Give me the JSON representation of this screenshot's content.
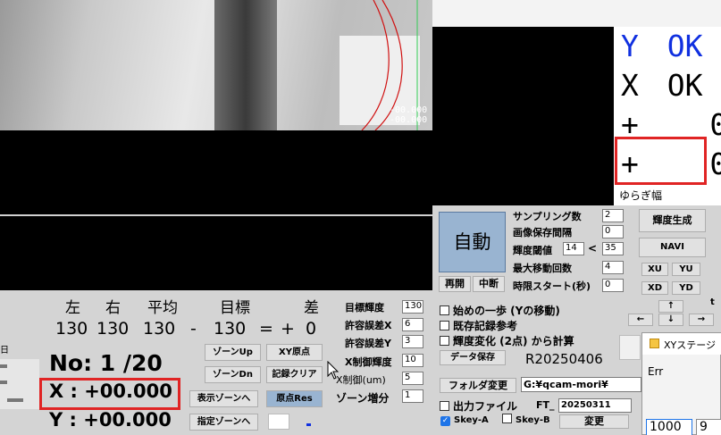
{
  "overlay": {
    "value1": "-00.000",
    "value2": "-00.000"
  },
  "status": {
    "y_label": "Y",
    "y_status": "OK",
    "x_label": "X",
    "x_status": "OK",
    "line3": "+    0",
    "line4": "+    0",
    "yuragi": "ゆらぎ幅"
  },
  "controls": {
    "auto_button": "自動",
    "resume_button": "再開",
    "stop_button": "中断",
    "sampling_label": "サンプリング数",
    "sampling_value": "2",
    "interval_label": "画像保存間隔",
    "interval_value": "0",
    "threshold_label": "輝度閾値",
    "threshold_value": "14",
    "threshold_op": "<",
    "threshold_value2": "35",
    "maxmove_label": "最大移動回数",
    "maxmove_value": "4",
    "timestart_label": "時限スタート(秒)",
    "timestart_value": "0",
    "gen_button": "輝度生成",
    "navi_button": "NAVI",
    "xu": "XU",
    "yu": "YU",
    "xd": "XD",
    "yd": "YD",
    "arrows": {
      "up": "↑",
      "down": "↓",
      "left": "←",
      "right": "→",
      "t": "t"
    }
  },
  "table": {
    "headers": [
      "左",
      "右",
      "平均",
      "目標",
      "差"
    ],
    "values": [
      "130",
      "130",
      "130",
      "-",
      "130",
      "=",
      "+",
      "0"
    ]
  },
  "readout": {
    "no": "No: 1 /20",
    "x": "X : +00.000",
    "y": "Y : +00.000"
  },
  "zone_buttons": {
    "zone_up": "ゾーンUp",
    "zone_dn": "ゾーンDn",
    "show_zone": "表示ゾーンへ",
    "set_zone": "指定ゾーンへ",
    "xy_origin": "XY原点",
    "clear_record": "記録クリア",
    "origin_res": "原点Res"
  },
  "settings": {
    "target_label": "目標輝度",
    "target_value": "130",
    "errx_label": "許容誤差X",
    "errx_value": "6",
    "erry_label": "許容誤差Y",
    "erry_value": "3",
    "xctrl_label": "X制御輝度",
    "xctrl_value": "10",
    "xum_label": "X制御(um)",
    "xum_value": "5",
    "zone_inc_label": "ゾーン増分",
    "zone_inc_value": "1"
  },
  "checks": {
    "first_step": "始めの一歩 (Yの移動)",
    "existing": "既存記録参考",
    "brightness_change": "輝度変化 (2点) から計算"
  },
  "save_button": "データ保存",
  "record_id": "R20250406",
  "folder_button": "フォルダ変更",
  "folder_path": "G:¥qcam-mori¥",
  "output_label": "出力ファイル",
  "ft_label": "FT_",
  "ft_value": "20250311",
  "skey_a": "Skey-A",
  "skey_b": "Skey-B",
  "change_button": "変更",
  "popup": {
    "title": "XYステージ",
    "text": "Err",
    "input": "1000",
    "input2": "9"
  }
}
